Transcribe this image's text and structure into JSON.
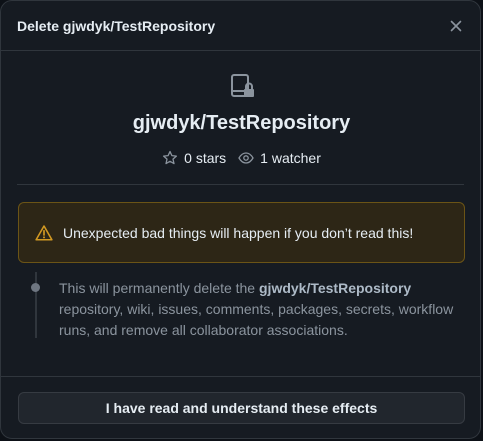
{
  "dialog": {
    "title": "Delete gjwdyk/TestRepository",
    "close_icon": "close-icon"
  },
  "repo": {
    "icon": "repo-locked-icon",
    "name": "gjwdyk/TestRepository",
    "stars": "0 stars",
    "star_icon": "star-icon",
    "watchers": "1 watcher",
    "watch_icon": "eye-icon"
  },
  "warning": {
    "icon": "alert-triangle-icon",
    "text": "Unexpected bad things will happen if you don’t read this!",
    "icon_color": "#d29922"
  },
  "effects": {
    "prefix": "This will permanently delete the ",
    "repo_bold": "gjwdyk/TestRepository",
    "suffix": " repository, wiki, issues, comments, packages, secrets, workflow runs, and remove all collaborator associations."
  },
  "footer": {
    "confirm_label": "I have read and understand these effects"
  }
}
